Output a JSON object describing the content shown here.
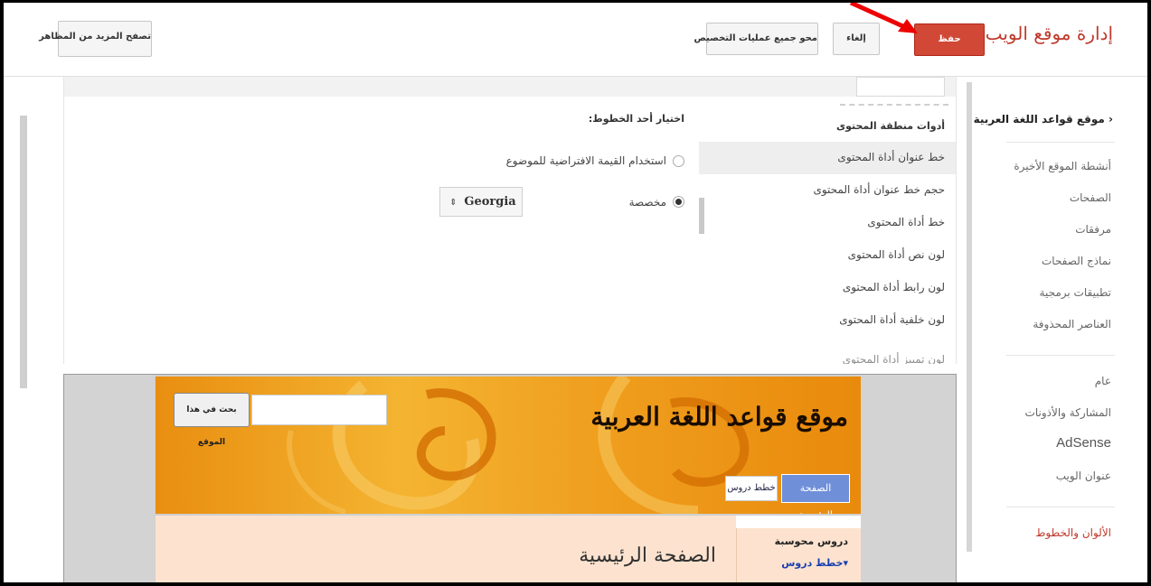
{
  "header": {
    "site_title": "إدارة موقع الويب",
    "save_label": "حفظ",
    "cancel_label": "إلغاء",
    "clear_label": "محو جميع عمليات التخصيص",
    "more_themes_label": "تصفح المزيد من المظاهر"
  },
  "sidebar": {
    "site_name": "موقع قواعد اللغة العربية",
    "items": [
      {
        "label": "أنشطة الموقع الأخيرة"
      },
      {
        "label": "الصفحات"
      },
      {
        "label": "مرفقات"
      },
      {
        "label": "نماذج الصفحات"
      },
      {
        "label": "تطبيقات برمجية"
      },
      {
        "label": "العناصر المحذوفة"
      },
      {
        "label": "عام"
      },
      {
        "label": "المشاركة والأذونات"
      },
      {
        "label": "AdSense"
      },
      {
        "label": "عنوان الويب"
      },
      {
        "label": "الألوان والخطوط"
      }
    ]
  },
  "tools": {
    "partial_top": "...",
    "header": "أدوات منطقة المحتوى",
    "items": [
      {
        "label": "خط عنوان أداة المحتوى",
        "selected": true
      },
      {
        "label": "حجم خط عنوان أداة المحتوى"
      },
      {
        "label": "خط أداة المحتوى"
      },
      {
        "label": "لون نص أداة المحتوى"
      },
      {
        "label": "لون رابط أداة المحتوى"
      },
      {
        "label": "لون خلفية أداة المحتوى"
      },
      {
        "label": "لون تمييز أداة المحتوى"
      }
    ]
  },
  "font_picker": {
    "title": "اختيار أحد الخطوط:",
    "option_default": "استخدام القيمة الافتراضية للموضوع",
    "option_custom": "مخصصة",
    "selected_option": "custom",
    "font_value": "Georgia"
  },
  "preview": {
    "site_title": "موقع قواعد اللغة العربية",
    "search_button": "بحث في هذا الموقع",
    "search_value": "",
    "tab_home": "الصفحة الرئيسية",
    "tab_plans": "خطط دروس",
    "side_title": "دروس محوسبة",
    "side_link": "خطط دروس",
    "page_heading": "الصفحة الرئيسية"
  },
  "colors": {
    "accent": "#c0392b",
    "save_button": "#d14836",
    "banner_orange": "#f0a020",
    "content_bg": "#fde3cf",
    "tab_home_bg": "#6f8fd8"
  }
}
